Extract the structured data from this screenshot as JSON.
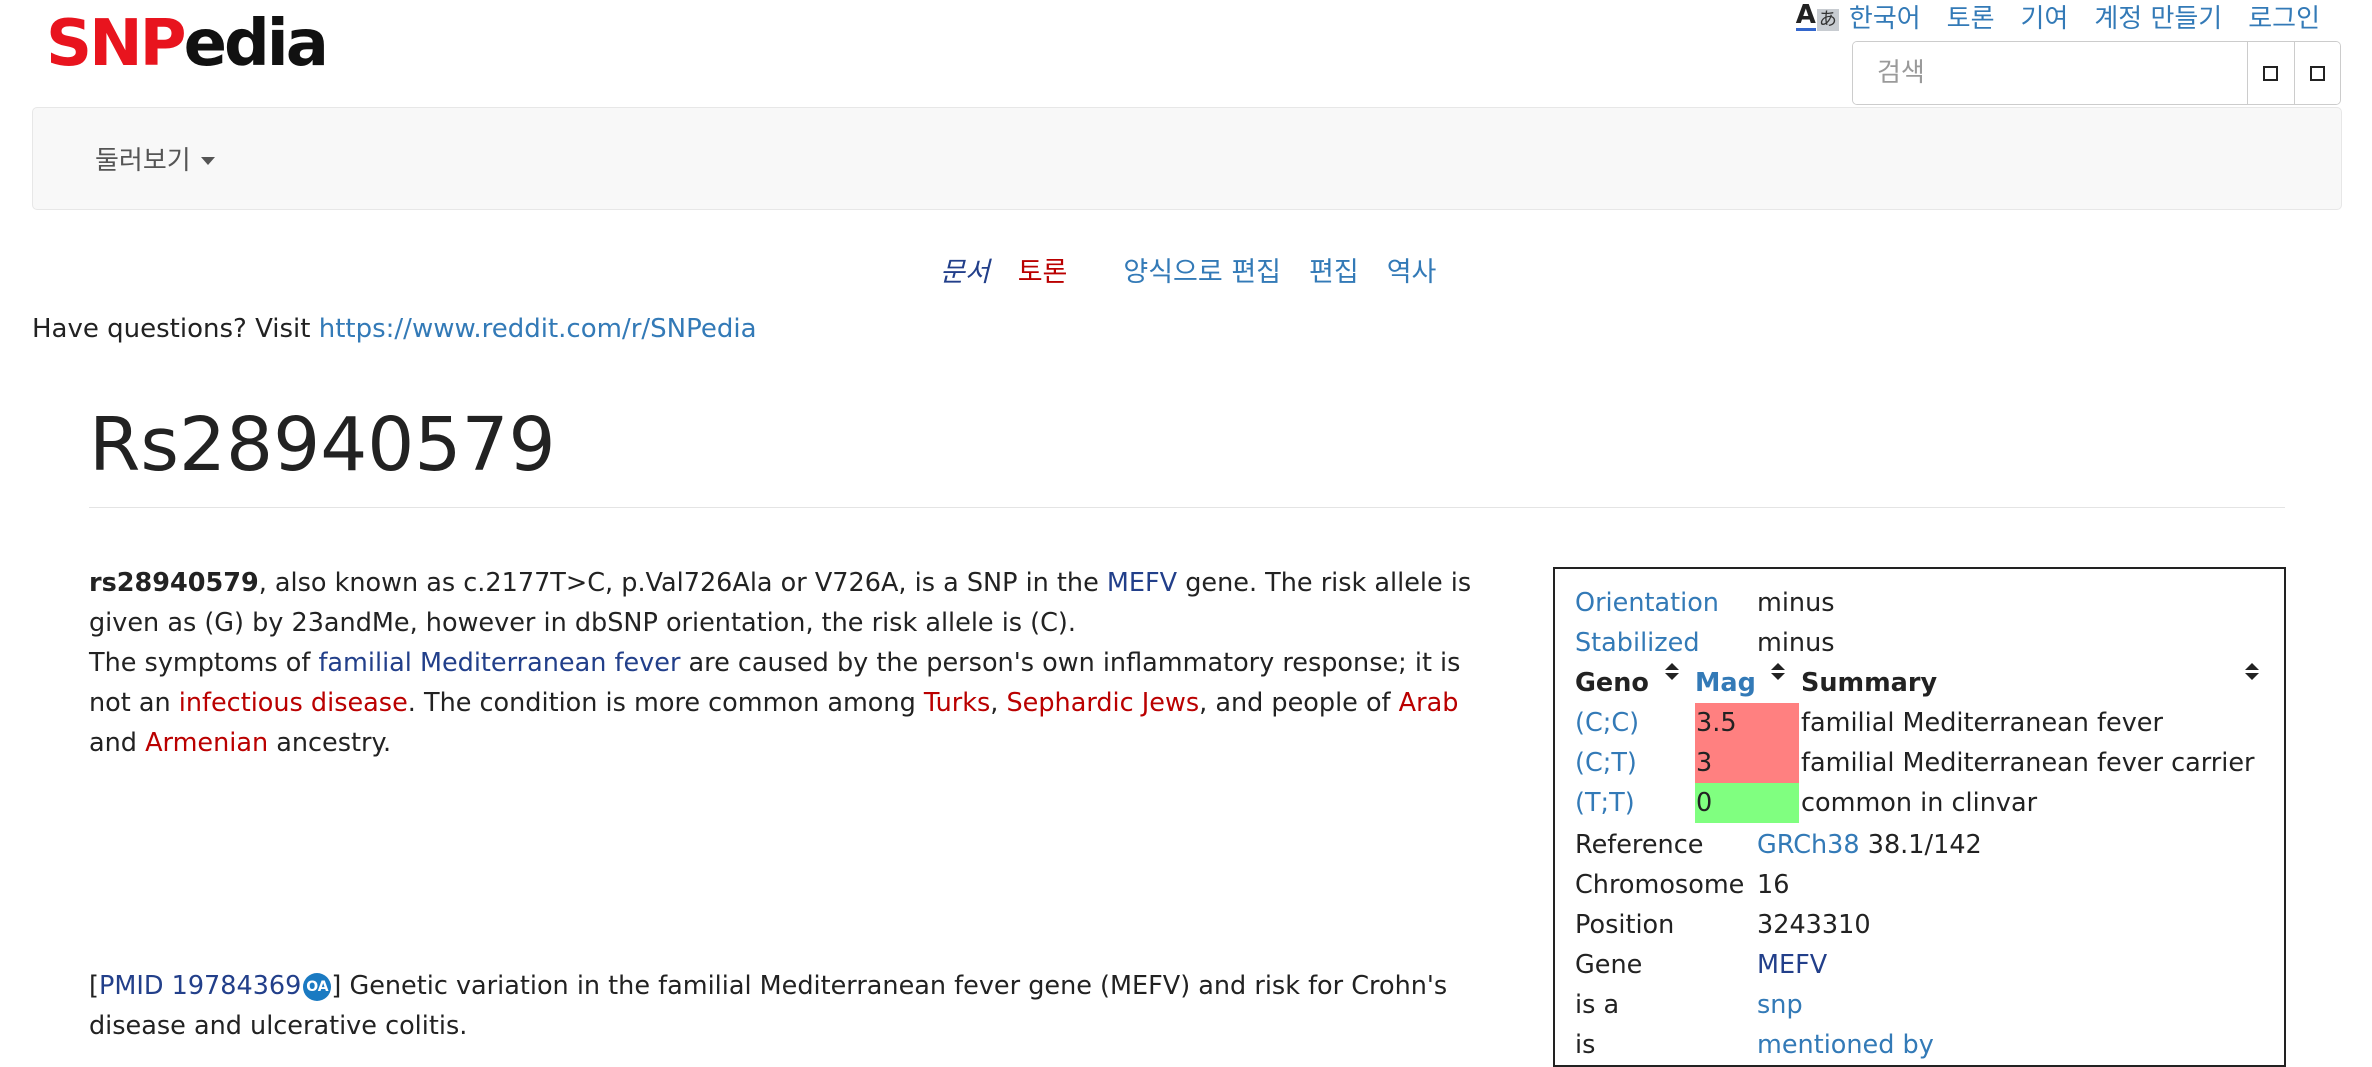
{
  "logo": {
    "part1": "SNP",
    "part2": "edia"
  },
  "top_links": {
    "language": "한국어",
    "talk": "토론",
    "contributions": "기여",
    "create_account": "계정 만들기",
    "login": "로그인"
  },
  "uls_icon": {
    "a": "A",
    "b": "あ"
  },
  "search": {
    "placeholder": "검색"
  },
  "navbar": {
    "browse": "둘러보기"
  },
  "page_tabs": {
    "document": "문서",
    "talk": "토론",
    "visual_edit": "양식으로 편집",
    "edit": "편집",
    "history": "역사"
  },
  "notice": {
    "text": "Have questions? Visit ",
    "link": "https://www.reddit.com/r/SNPedia"
  },
  "page_title": "Rs28940579",
  "body": {
    "p1_bold": "rs28940579",
    "p1_a": ", also known as c.2177T>C, p.Val726Ala or V726A, is a SNP in the ",
    "p1_gene": "MEFV",
    "p1_b": " gene. The risk allele is given as (G) by 23andMe, however in dbSNP orientation, the risk allele is (C).",
    "p2_a": "The symptoms of ",
    "p2_fmf": "familial Mediterranean fever",
    "p2_b": " are caused by the person's own inflammatory response; it is not an ",
    "p2_inf": "infectious disease",
    "p2_c": ". The condition is more common among ",
    "p2_turks": "Turks",
    "p2_comma": ", ",
    "p2_seph": "Sephardic Jews",
    "p2_d": ", and people of ",
    "p2_arab": "Arab",
    "p2_and": " and ",
    "p2_arm": "Armenian",
    "p2_e": " ancestry."
  },
  "pmid": {
    "open": "[",
    "link": "PMID 19784369",
    "oa": "OA",
    "text": "] Genetic variation in the familial Mediterranean fever gene (MEFV) and risk for Crohn's disease and ulcerative colitis."
  },
  "infobox": {
    "orientation_label": "Orientation",
    "orientation_value": "minus",
    "stabilized_label": "Stabilized",
    "stabilized_value": "minus",
    "headers": {
      "geno": "Geno",
      "mag": "Mag",
      "summary": "Summary"
    },
    "genotypes": [
      {
        "geno": "(C;C)",
        "mag": "3.5",
        "summary": "familial Mediterranean fever",
        "color": "#ff8080"
      },
      {
        "geno": "(C;T)",
        "mag": "3",
        "summary": "familial Mediterranean fever carrier",
        "color": "#ff8080"
      },
      {
        "geno": "(T;T)",
        "mag": "0",
        "summary": "common in clinvar",
        "color": "#80ff80"
      }
    ],
    "reference_label": "Reference",
    "reference_link": "GRCh38",
    "reference_value": " 38.1/142",
    "chromosome_label": "Chromosome",
    "chromosome_value": "16",
    "position_label": "Position",
    "position_value": "3243310",
    "gene_label": "Gene",
    "gene_value": "MEFV",
    "isa_label": "is a",
    "isa_value": "snp",
    "partial_label": "is",
    "partial_value": "mentioned by"
  }
}
